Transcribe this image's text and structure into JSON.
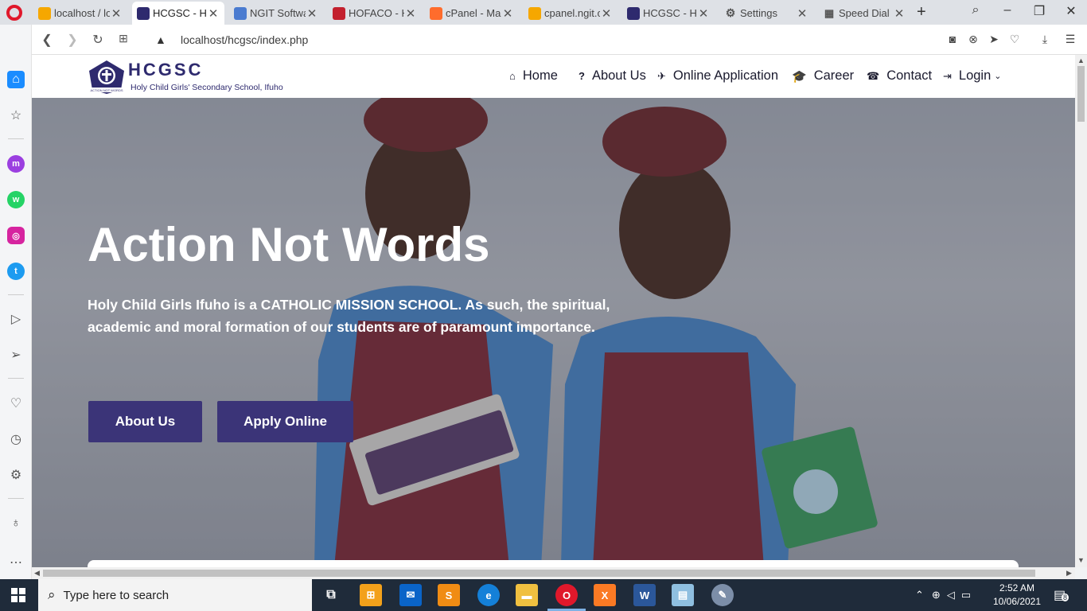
{
  "browser": {
    "tabs": [
      {
        "title": "localhost / lo",
        "favicon": "phpmyadmin-icon",
        "active": false
      },
      {
        "title": "HCGSC - Ho",
        "favicon": "school-crest-icon",
        "active": true
      },
      {
        "title": "NGIT Softwa",
        "favicon": "ngit-icon",
        "active": false
      },
      {
        "title": "HOFACO - H",
        "favicon": "hofaco-icon",
        "active": false
      },
      {
        "title": "cPanel - Mai",
        "favicon": "cpanel-icon",
        "active": false
      },
      {
        "title": "cpanel.ngit.c",
        "favicon": "phpmyadmin-icon",
        "active": false
      },
      {
        "title": "HCGSC - Ho",
        "favicon": "school-crest-icon",
        "active": false
      },
      {
        "title": "Settings",
        "favicon": "gear-icon",
        "active": false
      },
      {
        "title": "Speed Dial",
        "favicon": "grid-icon",
        "active": false
      }
    ],
    "url": "localhost/hcgsc/index.php"
  },
  "site": {
    "logo_name": "HCGSC",
    "logo_subtitle": "Holy Child Girls' Secondary School, Ifuho",
    "logo_motto": "ACTION NOT WORDS",
    "nav": [
      {
        "label": "Home",
        "icon": "home-icon"
      },
      {
        "label": "About Us",
        "icon": "question-icon"
      },
      {
        "label": "Online Application",
        "icon": "paper-plane-icon"
      },
      {
        "label": "Career",
        "icon": "graduation-cap-icon"
      },
      {
        "label": "Contact",
        "icon": "phone-icon"
      },
      {
        "label": "Login",
        "icon": "sign-in-icon"
      }
    ],
    "hero": {
      "title": "Action Not Words",
      "text": "Holy Child Girls Ifuho is a CATHOLIC MISSION SCHOOL. As such, the spiritual, academic and moral formation of our students are of paramount importance.",
      "about_button": "About Us",
      "apply_button": "Apply Online"
    }
  },
  "taskbar": {
    "search_placeholder": "Type here to search",
    "time": "2:52 AM",
    "date": "10/06/2021",
    "notification_count": "8"
  },
  "colors": {
    "brand": "#2e2a6e",
    "button": "#3b3478",
    "opera_red": "#e0182b"
  }
}
